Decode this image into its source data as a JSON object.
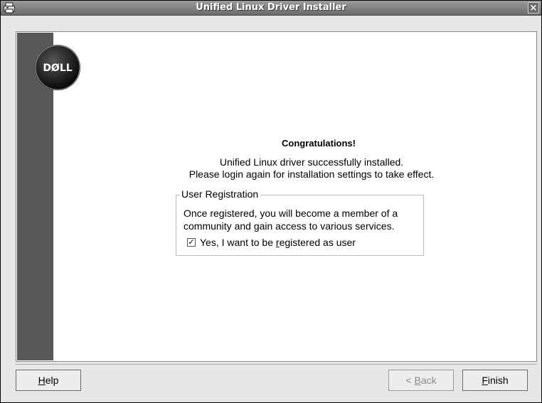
{
  "window": {
    "title": "Unified Linux Driver Installer",
    "close_glyph": "×"
  },
  "logo": {
    "text": "DØLL"
  },
  "main": {
    "heading": "Congratulations!",
    "message_line1": "Unified Linux driver successfully installed.",
    "message_line2": "Please login again for installation settings to take effect."
  },
  "registration": {
    "legend": "User Registration",
    "text_line1": "Once registered, you will become a member of a",
    "text_line2": "community and gain access to various services.",
    "checkbox_checked": true,
    "checkbox_label_before": "Yes, I want to be ",
    "checkbox_label_mnemonic": "r",
    "checkbox_label_after": "egistered as user"
  },
  "buttons": {
    "help_mnemonic": "H",
    "help_rest": "elp",
    "back_prefix": "< ",
    "back_mnemonic": "B",
    "back_rest": "ack",
    "finish_mnemonic": "F",
    "finish_rest": "inish"
  }
}
